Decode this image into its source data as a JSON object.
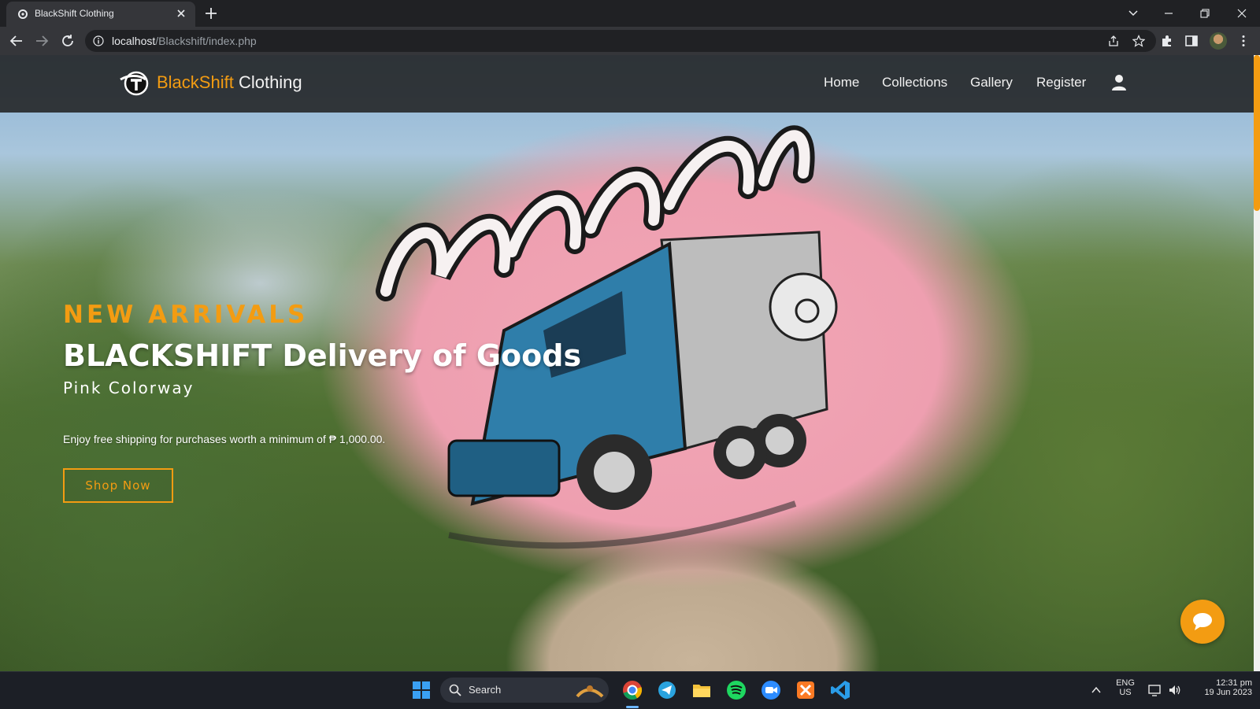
{
  "browser": {
    "tab_title": "BlackShift Clothing",
    "url_host": "localhost",
    "url_path": "/Blackshift/index.php"
  },
  "site": {
    "brand_accent": "BlackShift",
    "brand_rest": " Clothing",
    "nav": {
      "home": "Home",
      "collections": "Collections",
      "gallery": "Gallery",
      "register": "Register"
    }
  },
  "hero": {
    "kicker": "NEW ARRIVALS",
    "title": "BLACKSHIFT Delivery of Goods",
    "subtitle": "Pink Colorway",
    "text": "Enjoy free shipping for purchases worth a minimum of ₱ 1,000.00.",
    "button": "Shop Now"
  },
  "taskbar": {
    "search_label": "Search",
    "lang_top": "ENG",
    "lang_bottom": "US",
    "time": "12:31 pm",
    "date": "19 Jun 2023"
  },
  "colors": {
    "accent": "#f39c12",
    "navbar_bg": "#1e1e1e",
    "chrome_bg": "#202124"
  },
  "icons": {
    "user": "user-icon",
    "chat": "chat-icon",
    "shop_logo": "blackshift-logo-icon"
  }
}
